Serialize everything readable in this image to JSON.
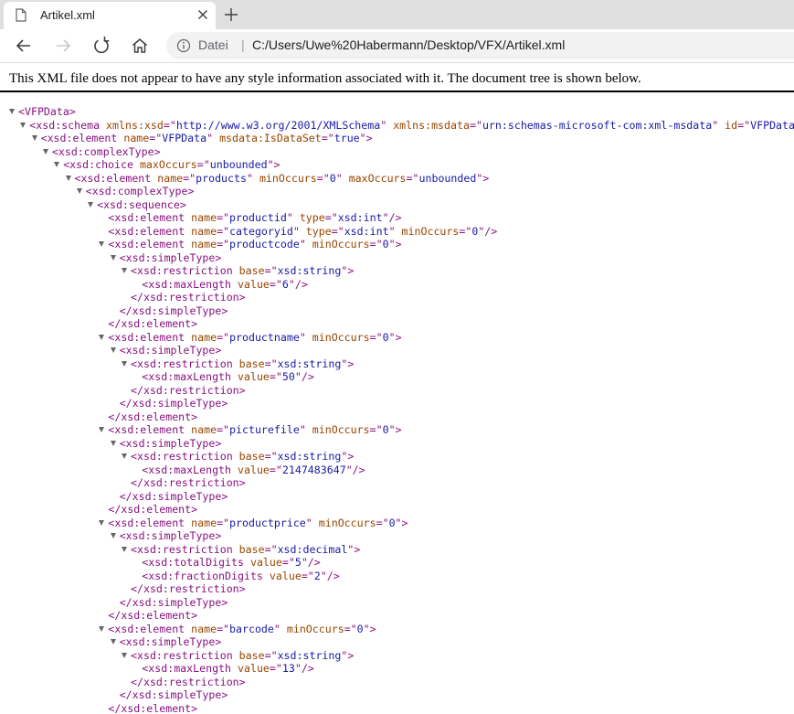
{
  "tab": {
    "title": "Artikel.xml",
    "icons": {
      "page": "page-icon",
      "close": "close-icon",
      "newtab": "plus-icon"
    }
  },
  "toolbar": {
    "icons": [
      "back-arrow-icon",
      "forward-arrow-icon",
      "refresh-icon",
      "home-icon",
      "info-icon"
    ]
  },
  "address": {
    "scheme": "Datei",
    "separator": "|",
    "url": "C:/Users/Uwe%20Habermann/Desktop/VFX/Artikel.xml"
  },
  "notice": "This XML file does not appear to have any style information associated with it. The document tree is shown below.",
  "colors": {
    "tag": "#881280",
    "attr_name": "#994500",
    "attr_value": "#1a1aa6",
    "tabstrip": "#e0e0e0"
  },
  "tree": [
    {
      "depth": 0,
      "toggle": true,
      "segs": [
        {
          "t": "tag",
          "v": "<VFPData>"
        }
      ]
    },
    {
      "depth": 1,
      "toggle": true,
      "segs": [
        {
          "t": "tag",
          "v": "<xsd:schema"
        },
        {
          "t": "an",
          "v": " xmlns:xsd"
        },
        {
          "t": "tag",
          "v": "=\""
        },
        {
          "t": "av",
          "v": "http://www.w3.org/2001/XMLSchema"
        },
        {
          "t": "tag",
          "v": "\""
        },
        {
          "t": "an",
          "v": " xmlns:msdata"
        },
        {
          "t": "tag",
          "v": "=\""
        },
        {
          "t": "av",
          "v": "urn:schemas-microsoft-com:xml-msdata"
        },
        {
          "t": "tag",
          "v": "\""
        },
        {
          "t": "an",
          "v": " id"
        },
        {
          "t": "tag",
          "v": "=\""
        },
        {
          "t": "av",
          "v": "VFPData"
        },
        {
          "t": "tag",
          "v": "\">"
        }
      ]
    },
    {
      "depth": 2,
      "toggle": true,
      "segs": [
        {
          "t": "tag",
          "v": "<xsd:element"
        },
        {
          "t": "an",
          "v": " name"
        },
        {
          "t": "tag",
          "v": "=\""
        },
        {
          "t": "av",
          "v": "VFPData"
        },
        {
          "t": "tag",
          "v": "\""
        },
        {
          "t": "an",
          "v": " msdata:IsDataSet"
        },
        {
          "t": "tag",
          "v": "=\""
        },
        {
          "t": "av",
          "v": "true"
        },
        {
          "t": "tag",
          "v": "\">"
        }
      ]
    },
    {
      "depth": 3,
      "toggle": true,
      "segs": [
        {
          "t": "tag",
          "v": "<xsd:complexType>"
        }
      ]
    },
    {
      "depth": 4,
      "toggle": true,
      "segs": [
        {
          "t": "tag",
          "v": "<xsd:choice"
        },
        {
          "t": "an",
          "v": " maxOccurs"
        },
        {
          "t": "tag",
          "v": "=\""
        },
        {
          "t": "av",
          "v": "unbounded"
        },
        {
          "t": "tag",
          "v": "\">"
        }
      ]
    },
    {
      "depth": 5,
      "toggle": true,
      "segs": [
        {
          "t": "tag",
          "v": "<xsd:element"
        },
        {
          "t": "an",
          "v": " name"
        },
        {
          "t": "tag",
          "v": "=\""
        },
        {
          "t": "av",
          "v": "products"
        },
        {
          "t": "tag",
          "v": "\""
        },
        {
          "t": "an",
          "v": " minOccurs"
        },
        {
          "t": "tag",
          "v": "=\""
        },
        {
          "t": "av",
          "v": "0"
        },
        {
          "t": "tag",
          "v": "\""
        },
        {
          "t": "an",
          "v": " maxOccurs"
        },
        {
          "t": "tag",
          "v": "=\""
        },
        {
          "t": "av",
          "v": "unbounded"
        },
        {
          "t": "tag",
          "v": "\">"
        }
      ]
    },
    {
      "depth": 6,
      "toggle": true,
      "segs": [
        {
          "t": "tag",
          "v": "<xsd:complexType>"
        }
      ]
    },
    {
      "depth": 7,
      "toggle": true,
      "segs": [
        {
          "t": "tag",
          "v": "<xsd:sequence>"
        }
      ]
    },
    {
      "depth": 8,
      "toggle": false,
      "segs": [
        {
          "t": "tag",
          "v": "<xsd:element"
        },
        {
          "t": "an",
          "v": " name"
        },
        {
          "t": "tag",
          "v": "=\""
        },
        {
          "t": "av",
          "v": "productid"
        },
        {
          "t": "tag",
          "v": "\""
        },
        {
          "t": "an",
          "v": " type"
        },
        {
          "t": "tag",
          "v": "=\""
        },
        {
          "t": "av",
          "v": "xsd:int"
        },
        {
          "t": "tag",
          "v": "\"/>"
        }
      ]
    },
    {
      "depth": 8,
      "toggle": false,
      "segs": [
        {
          "t": "tag",
          "v": "<xsd:element"
        },
        {
          "t": "an",
          "v": " name"
        },
        {
          "t": "tag",
          "v": "=\""
        },
        {
          "t": "av",
          "v": "categoryid"
        },
        {
          "t": "tag",
          "v": "\""
        },
        {
          "t": "an",
          "v": " type"
        },
        {
          "t": "tag",
          "v": "=\""
        },
        {
          "t": "av",
          "v": "xsd:int"
        },
        {
          "t": "tag",
          "v": "\""
        },
        {
          "t": "an",
          "v": " minOccurs"
        },
        {
          "t": "tag",
          "v": "=\""
        },
        {
          "t": "av",
          "v": "0"
        },
        {
          "t": "tag",
          "v": "\"/>"
        }
      ]
    },
    {
      "depth": 8,
      "toggle": true,
      "segs": [
        {
          "t": "tag",
          "v": "<xsd:element"
        },
        {
          "t": "an",
          "v": " name"
        },
        {
          "t": "tag",
          "v": "=\""
        },
        {
          "t": "av",
          "v": "productcode"
        },
        {
          "t": "tag",
          "v": "\""
        },
        {
          "t": "an",
          "v": " minOccurs"
        },
        {
          "t": "tag",
          "v": "=\""
        },
        {
          "t": "av",
          "v": "0"
        },
        {
          "t": "tag",
          "v": "\">"
        }
      ]
    },
    {
      "depth": 9,
      "toggle": true,
      "segs": [
        {
          "t": "tag",
          "v": "<xsd:simpleType>"
        }
      ]
    },
    {
      "depth": 10,
      "toggle": true,
      "segs": [
        {
          "t": "tag",
          "v": "<xsd:restriction"
        },
        {
          "t": "an",
          "v": " base"
        },
        {
          "t": "tag",
          "v": "=\""
        },
        {
          "t": "av",
          "v": "xsd:string"
        },
        {
          "t": "tag",
          "v": "\">"
        }
      ]
    },
    {
      "depth": 11,
      "toggle": false,
      "segs": [
        {
          "t": "tag",
          "v": "<xsd:maxLength"
        },
        {
          "t": "an",
          "v": " value"
        },
        {
          "t": "tag",
          "v": "=\""
        },
        {
          "t": "av",
          "v": "6"
        },
        {
          "t": "tag",
          "v": "\"/>"
        }
      ]
    },
    {
      "depth": 10,
      "toggle": false,
      "segs": [
        {
          "t": "tag",
          "v": "</xsd:restriction>"
        }
      ]
    },
    {
      "depth": 9,
      "toggle": false,
      "segs": [
        {
          "t": "tag",
          "v": "</xsd:simpleType>"
        }
      ]
    },
    {
      "depth": 8,
      "toggle": false,
      "segs": [
        {
          "t": "tag",
          "v": "</xsd:element>"
        }
      ]
    },
    {
      "depth": 8,
      "toggle": true,
      "segs": [
        {
          "t": "tag",
          "v": "<xsd:element"
        },
        {
          "t": "an",
          "v": " name"
        },
        {
          "t": "tag",
          "v": "=\""
        },
        {
          "t": "av",
          "v": "productname"
        },
        {
          "t": "tag",
          "v": "\""
        },
        {
          "t": "an",
          "v": " minOccurs"
        },
        {
          "t": "tag",
          "v": "=\""
        },
        {
          "t": "av",
          "v": "0"
        },
        {
          "t": "tag",
          "v": "\">"
        }
      ]
    },
    {
      "depth": 9,
      "toggle": true,
      "segs": [
        {
          "t": "tag",
          "v": "<xsd:simpleType>"
        }
      ]
    },
    {
      "depth": 10,
      "toggle": true,
      "segs": [
        {
          "t": "tag",
          "v": "<xsd:restriction"
        },
        {
          "t": "an",
          "v": " base"
        },
        {
          "t": "tag",
          "v": "=\""
        },
        {
          "t": "av",
          "v": "xsd:string"
        },
        {
          "t": "tag",
          "v": "\">"
        }
      ]
    },
    {
      "depth": 11,
      "toggle": false,
      "segs": [
        {
          "t": "tag",
          "v": "<xsd:maxLength"
        },
        {
          "t": "an",
          "v": " value"
        },
        {
          "t": "tag",
          "v": "=\""
        },
        {
          "t": "av",
          "v": "50"
        },
        {
          "t": "tag",
          "v": "\"/>"
        }
      ]
    },
    {
      "depth": 10,
      "toggle": false,
      "segs": [
        {
          "t": "tag",
          "v": "</xsd:restriction>"
        }
      ]
    },
    {
      "depth": 9,
      "toggle": false,
      "segs": [
        {
          "t": "tag",
          "v": "</xsd:simpleType>"
        }
      ]
    },
    {
      "depth": 8,
      "toggle": false,
      "segs": [
        {
          "t": "tag",
          "v": "</xsd:element>"
        }
      ]
    },
    {
      "depth": 8,
      "toggle": true,
      "segs": [
        {
          "t": "tag",
          "v": "<xsd:element"
        },
        {
          "t": "an",
          "v": " name"
        },
        {
          "t": "tag",
          "v": "=\""
        },
        {
          "t": "av",
          "v": "picturefile"
        },
        {
          "t": "tag",
          "v": "\""
        },
        {
          "t": "an",
          "v": " minOccurs"
        },
        {
          "t": "tag",
          "v": "=\""
        },
        {
          "t": "av",
          "v": "0"
        },
        {
          "t": "tag",
          "v": "\">"
        }
      ]
    },
    {
      "depth": 9,
      "toggle": true,
      "segs": [
        {
          "t": "tag",
          "v": "<xsd:simpleType>"
        }
      ]
    },
    {
      "depth": 10,
      "toggle": true,
      "segs": [
        {
          "t": "tag",
          "v": "<xsd:restriction"
        },
        {
          "t": "an",
          "v": " base"
        },
        {
          "t": "tag",
          "v": "=\""
        },
        {
          "t": "av",
          "v": "xsd:string"
        },
        {
          "t": "tag",
          "v": "\">"
        }
      ]
    },
    {
      "depth": 11,
      "toggle": false,
      "segs": [
        {
          "t": "tag",
          "v": "<xsd:maxLength"
        },
        {
          "t": "an",
          "v": " value"
        },
        {
          "t": "tag",
          "v": "=\""
        },
        {
          "t": "av",
          "v": "2147483647"
        },
        {
          "t": "tag",
          "v": "\"/>"
        }
      ]
    },
    {
      "depth": 10,
      "toggle": false,
      "segs": [
        {
          "t": "tag",
          "v": "</xsd:restriction>"
        }
      ]
    },
    {
      "depth": 9,
      "toggle": false,
      "segs": [
        {
          "t": "tag",
          "v": "</xsd:simpleType>"
        }
      ]
    },
    {
      "depth": 8,
      "toggle": false,
      "segs": [
        {
          "t": "tag",
          "v": "</xsd:element>"
        }
      ]
    },
    {
      "depth": 8,
      "toggle": true,
      "segs": [
        {
          "t": "tag",
          "v": "<xsd:element"
        },
        {
          "t": "an",
          "v": " name"
        },
        {
          "t": "tag",
          "v": "=\""
        },
        {
          "t": "av",
          "v": "productprice"
        },
        {
          "t": "tag",
          "v": "\""
        },
        {
          "t": "an",
          "v": " minOccurs"
        },
        {
          "t": "tag",
          "v": "=\""
        },
        {
          "t": "av",
          "v": "0"
        },
        {
          "t": "tag",
          "v": "\">"
        }
      ]
    },
    {
      "depth": 9,
      "toggle": true,
      "segs": [
        {
          "t": "tag",
          "v": "<xsd:simpleType>"
        }
      ]
    },
    {
      "depth": 10,
      "toggle": true,
      "segs": [
        {
          "t": "tag",
          "v": "<xsd:restriction"
        },
        {
          "t": "an",
          "v": " base"
        },
        {
          "t": "tag",
          "v": "=\""
        },
        {
          "t": "av",
          "v": "xsd:decimal"
        },
        {
          "t": "tag",
          "v": "\">"
        }
      ]
    },
    {
      "depth": 11,
      "toggle": false,
      "segs": [
        {
          "t": "tag",
          "v": "<xsd:totalDigits"
        },
        {
          "t": "an",
          "v": " value"
        },
        {
          "t": "tag",
          "v": "=\""
        },
        {
          "t": "av",
          "v": "5"
        },
        {
          "t": "tag",
          "v": "\"/>"
        }
      ]
    },
    {
      "depth": 11,
      "toggle": false,
      "segs": [
        {
          "t": "tag",
          "v": "<xsd:fractionDigits"
        },
        {
          "t": "an",
          "v": " value"
        },
        {
          "t": "tag",
          "v": "=\""
        },
        {
          "t": "av",
          "v": "2"
        },
        {
          "t": "tag",
          "v": "\"/>"
        }
      ]
    },
    {
      "depth": 10,
      "toggle": false,
      "segs": [
        {
          "t": "tag",
          "v": "</xsd:restriction>"
        }
      ]
    },
    {
      "depth": 9,
      "toggle": false,
      "segs": [
        {
          "t": "tag",
          "v": "</xsd:simpleType>"
        }
      ]
    },
    {
      "depth": 8,
      "toggle": false,
      "segs": [
        {
          "t": "tag",
          "v": "</xsd:element>"
        }
      ]
    },
    {
      "depth": 8,
      "toggle": true,
      "segs": [
        {
          "t": "tag",
          "v": "<xsd:element"
        },
        {
          "t": "an",
          "v": " name"
        },
        {
          "t": "tag",
          "v": "=\""
        },
        {
          "t": "av",
          "v": "barcode"
        },
        {
          "t": "tag",
          "v": "\""
        },
        {
          "t": "an",
          "v": " minOccurs"
        },
        {
          "t": "tag",
          "v": "=\""
        },
        {
          "t": "av",
          "v": "0"
        },
        {
          "t": "tag",
          "v": "\">"
        }
      ]
    },
    {
      "depth": 9,
      "toggle": true,
      "segs": [
        {
          "t": "tag",
          "v": "<xsd:simpleType>"
        }
      ]
    },
    {
      "depth": 10,
      "toggle": true,
      "segs": [
        {
          "t": "tag",
          "v": "<xsd:restriction"
        },
        {
          "t": "an",
          "v": " base"
        },
        {
          "t": "tag",
          "v": "=\""
        },
        {
          "t": "av",
          "v": "xsd:string"
        },
        {
          "t": "tag",
          "v": "\">"
        }
      ]
    },
    {
      "depth": 11,
      "toggle": false,
      "segs": [
        {
          "t": "tag",
          "v": "<xsd:maxLength"
        },
        {
          "t": "an",
          "v": " value"
        },
        {
          "t": "tag",
          "v": "=\""
        },
        {
          "t": "av",
          "v": "13"
        },
        {
          "t": "tag",
          "v": "\"/>"
        }
      ]
    },
    {
      "depth": 10,
      "toggle": false,
      "segs": [
        {
          "t": "tag",
          "v": "</xsd:restriction>"
        }
      ]
    },
    {
      "depth": 9,
      "toggle": false,
      "segs": [
        {
          "t": "tag",
          "v": "</xsd:simpleType>"
        }
      ]
    },
    {
      "depth": 8,
      "toggle": false,
      "segs": [
        {
          "t": "tag",
          "v": "</xsd:element>"
        }
      ]
    }
  ]
}
